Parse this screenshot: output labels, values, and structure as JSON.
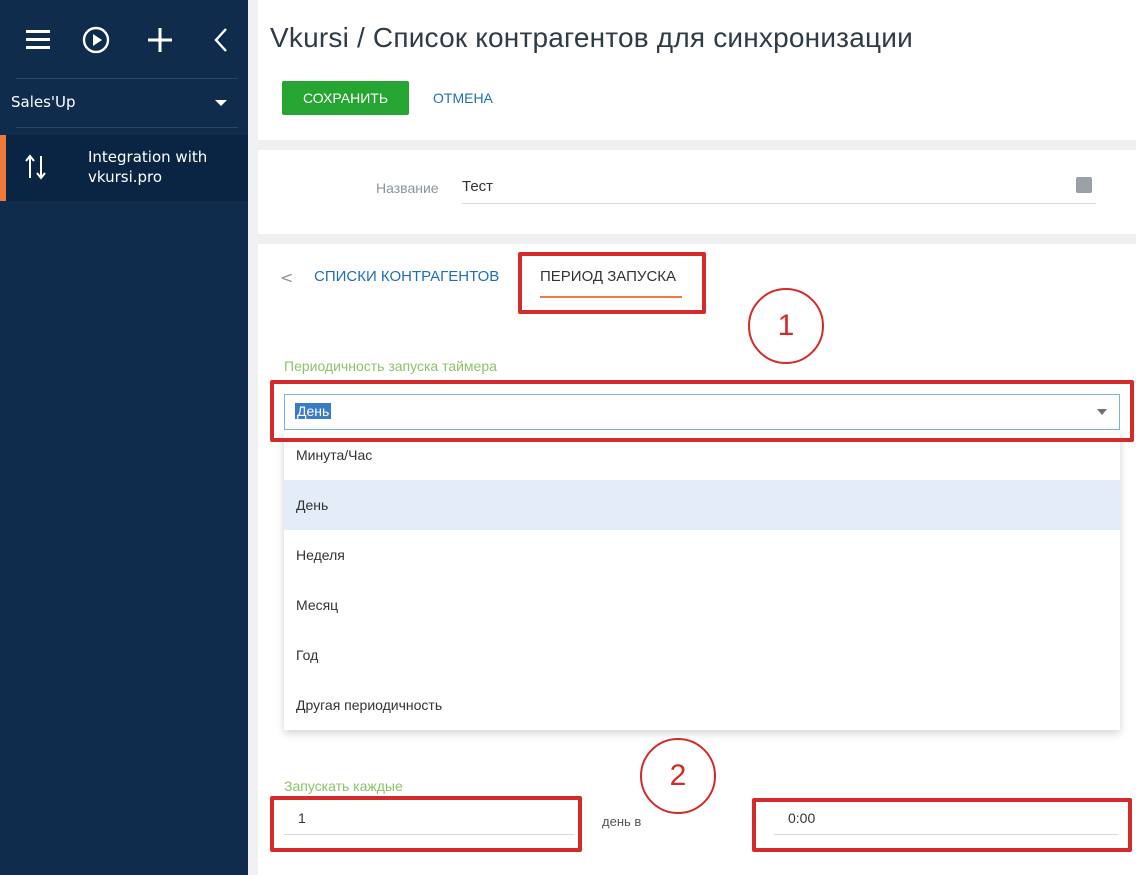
{
  "sidebar": {
    "workspace": "Sales'Up",
    "nav_item_label": "Integration with vkursi.pro"
  },
  "header": {
    "title": "Vkursi / Список контрагентов для синхронизации",
    "save_label": "СОХРАНИТЬ",
    "cancel_label": "ОТМЕНА"
  },
  "record": {
    "name_label": "Название",
    "name_value": "Тест"
  },
  "tabs": {
    "back_symbol": "<",
    "accounts": "СПИСКИ КОНТРАГЕНТОВ",
    "period": "ПЕРИОД ЗАПУСКА"
  },
  "period": {
    "label": "Периодичность запуска таймера",
    "selected": "День",
    "options": [
      "Минута/Час",
      "День",
      "Неделя",
      "Месяц",
      "Год",
      "Другая периодичность"
    ]
  },
  "schedule": {
    "every_label": "Запускать каждые",
    "every_value": "1",
    "day_in": "день в",
    "time_value": "0:00"
  },
  "annotations": {
    "marker_1": "1",
    "marker_2": "2"
  },
  "colors": {
    "sidebar_bg": "#0f2c4d",
    "accent_orange": "#f07a3b",
    "save_green": "#26a533",
    "link_blue": "#1f6fb8",
    "label_green": "#8cc36a",
    "annotation_red": "#d42a2a"
  }
}
